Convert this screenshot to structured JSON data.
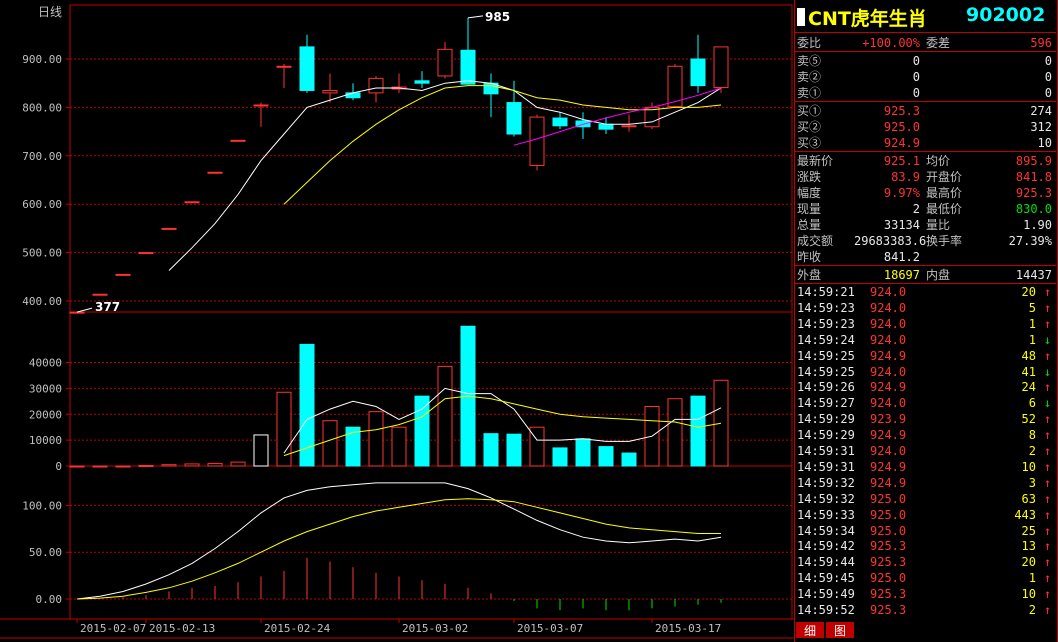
{
  "chart_area": {
    "period_label": "日线",
    "price_axis_ticks": [
      "900.00",
      "800.00",
      "700.00",
      "600.00",
      "500.00",
      "400.00"
    ],
    "price_axis_values": [
      900,
      800,
      700,
      600,
      500,
      400
    ],
    "volume_axis_ticks": [
      "40000",
      "30000",
      "20000",
      "10000",
      "0"
    ],
    "volume_axis_values": [
      40000,
      30000,
      20000,
      10000,
      0
    ],
    "indicator_axis_ticks": [
      "100.00",
      "50.00",
      "0.00"
    ],
    "indicator_axis_values": [
      100,
      50,
      0
    ],
    "date_labels": [
      "2015-02-07",
      "2015-02-13",
      "2015-02-24",
      "2015-03-02",
      "2015-03-07",
      "2015-03-17"
    ],
    "high_marker": "985",
    "low_marker": "377",
    "colors": {
      "up": "#ff3232",
      "down": "#00ffff",
      "grid": "#c00000",
      "ma_short": "#ffffff",
      "ma_long": "#ffff00",
      "ma_third": "#ff00ff"
    }
  },
  "chart_data": [
    {
      "type": "candlestick",
      "title": "",
      "ylim": [
        380,
        990
      ],
      "grid": true,
      "candles": [
        {
          "o": 377,
          "h": 377,
          "l": 377,
          "c": 377,
          "dir": "up"
        },
        {
          "o": 414,
          "h": 414,
          "l": 414,
          "c": 414,
          "dir": "up"
        },
        {
          "o": 455,
          "h": 455,
          "l": 455,
          "c": 455,
          "dir": "up"
        },
        {
          "o": 500,
          "h": 500,
          "l": 500,
          "c": 500,
          "dir": "up"
        },
        {
          "o": 550,
          "h": 550,
          "l": 550,
          "c": 550,
          "dir": "up"
        },
        {
          "o": 605,
          "h": 605,
          "l": 605,
          "c": 605,
          "dir": "up"
        },
        {
          "o": 666,
          "h": 666,
          "l": 666,
          "c": 666,
          "dir": "up"
        },
        {
          "o": 732,
          "h": 732,
          "l": 732,
          "c": 732,
          "dir": "up"
        },
        {
          "o": 805,
          "h": 810,
          "l": 760,
          "c": 805,
          "dir": "up"
        },
        {
          "o": 885,
          "h": 890,
          "l": 840,
          "c": 885,
          "dir": "up"
        },
        {
          "o": 925,
          "h": 950,
          "l": 830,
          "c": 835,
          "dir": "down"
        },
        {
          "o": 830,
          "h": 870,
          "l": 810,
          "c": 835,
          "dir": "up"
        },
        {
          "o": 830,
          "h": 850,
          "l": 815,
          "c": 820,
          "dir": "down"
        },
        {
          "o": 830,
          "h": 865,
          "l": 810,
          "c": 860,
          "dir": "up"
        },
        {
          "o": 838,
          "h": 870,
          "l": 830,
          "c": 842,
          "dir": "up"
        },
        {
          "o": 855,
          "h": 875,
          "l": 840,
          "c": 850,
          "dir": "down"
        },
        {
          "o": 865,
          "h": 935,
          "l": 860,
          "c": 920,
          "dir": "up"
        },
        {
          "o": 918,
          "h": 985,
          "l": 860,
          "c": 848,
          "dir": "down"
        },
        {
          "o": 850,
          "h": 870,
          "l": 780,
          "c": 828,
          "dir": "down"
        },
        {
          "o": 810,
          "h": 855,
          "l": 740,
          "c": 745,
          "dir": "down"
        },
        {
          "o": 680,
          "h": 785,
          "l": 670,
          "c": 780,
          "dir": "up"
        },
        {
          "o": 778,
          "h": 790,
          "l": 755,
          "c": 762,
          "dir": "down"
        },
        {
          "o": 772,
          "h": 790,
          "l": 735,
          "c": 760,
          "dir": "down"
        },
        {
          "o": 765,
          "h": 780,
          "l": 745,
          "c": 755,
          "dir": "down"
        },
        {
          "o": 760,
          "h": 785,
          "l": 750,
          "c": 762,
          "dir": "up"
        },
        {
          "o": 760,
          "h": 810,
          "l": 755,
          "c": 800,
          "dir": "up"
        },
        {
          "o": 802,
          "h": 890,
          "l": 800,
          "c": 885,
          "dir": "up"
        },
        {
          "o": 900,
          "h": 950,
          "l": 830,
          "c": 845,
          "dir": "down"
        },
        {
          "o": 841,
          "h": 925,
          "l": 830,
          "c": 925,
          "dir": "up"
        }
      ],
      "ma_short": [
        null,
        null,
        null,
        null,
        null,
        null,
        null,
        null,
        null,
        null,
        null,
        null,
        null,
        null,
        null,
        null,
        null,
        null,
        null,
        null,
        null,
        null,
        null,
        null,
        null,
        null,
        null,
        null,
        null
      ],
      "series": [
        {
          "name": "",
          "values": [
            null,
            null,
            null,
            null,
            463,
            510,
            560,
            620,
            690,
            745,
            800,
            815,
            830,
            840,
            840,
            835,
            850,
            855,
            850,
            835,
            800,
            790,
            775,
            765,
            765,
            770,
            790,
            810,
            840
          ]
        },
        {
          "name": "",
          "values": [
            null,
            null,
            null,
            null,
            null,
            null,
            null,
            null,
            null,
            600,
            645,
            690,
            730,
            765,
            795,
            820,
            840,
            845,
            845,
            835,
            820,
            815,
            805,
            800,
            795,
            795,
            800,
            800,
            805
          ]
        },
        {
          "name": "",
          "values": [
            null,
            null,
            null,
            null,
            null,
            null,
            null,
            null,
            null,
            null,
            null,
            null,
            null,
            null,
            null,
            null,
            null,
            null,
            null,
            722,
            735,
            750,
            765,
            778,
            790,
            800,
            812,
            825,
            840
          ]
        }
      ]
    },
    {
      "type": "bar",
      "title": "",
      "ylim": [
        0,
        48000
      ],
      "values": [
        0,
        0,
        0,
        200,
        500,
        800,
        1000,
        1500,
        12000,
        28500,
        47000,
        17500,
        15000,
        21000,
        15000,
        27000,
        38500,
        54000,
        12500,
        12300,
        15000,
        7000,
        10500,
        7500,
        5000,
        23000,
        26000,
        27000,
        33134
      ],
      "dirs": [
        "up",
        "up",
        "up",
        "up",
        "up",
        "up",
        "up",
        "up",
        "up",
        "up",
        "down",
        "up",
        "down",
        "up",
        "up",
        "down",
        "up",
        "down",
        "down",
        "down",
        "up",
        "down",
        "down",
        "down",
        "down",
        "up",
        "up",
        "down",
        "up"
      ],
      "series": [
        {
          "name": "",
          "values": [
            null,
            null,
            null,
            null,
            null,
            null,
            null,
            null,
            null,
            5000,
            18000,
            22000,
            25000,
            23000,
            18000,
            22000,
            30000,
            28000,
            28000,
            22000,
            10000,
            10000,
            10500,
            9500,
            9500,
            11500,
            18000,
            18000,
            22500
          ]
        },
        {
          "name": "",
          "values": [
            null,
            null,
            null,
            null,
            null,
            null,
            null,
            null,
            null,
            4000,
            7000,
            10000,
            13000,
            14000,
            16000,
            19000,
            26000,
            27000,
            26000,
            24000,
            22000,
            20000,
            19000,
            18500,
            18000,
            17500,
            17000,
            15000,
            16500
          ]
        }
      ]
    },
    {
      "type": "line",
      "title": "",
      "ylim": [
        -12,
        128
      ],
      "series": [
        {
          "name": "",
          "values": [
            0,
            3,
            8,
            16,
            26,
            38,
            54,
            72,
            92,
            108,
            116,
            120,
            122,
            124,
            124,
            124,
            124,
            118,
            108,
            96,
            84,
            74,
            66,
            62,
            60,
            62,
            64,
            62,
            66
          ]
        },
        {
          "name": "",
          "values": [
            0,
            1,
            3,
            7,
            12,
            19,
            28,
            38,
            50,
            62,
            72,
            80,
            88,
            94,
            98,
            102,
            106,
            107,
            106,
            104,
            98,
            92,
            86,
            80,
            76,
            74,
            72,
            70,
            70
          ]
        }
      ],
      "bars": [
        0,
        0,
        2,
        4,
        8,
        12,
        14,
        18,
        24,
        30,
        44,
        40,
        34,
        28,
        24,
        20,
        16,
        12,
        6,
        -2,
        -10,
        -12,
        -10,
        -12,
        -12,
        -10,
        -8,
        -6,
        -4
      ]
    }
  ],
  "panel": {
    "title": "CNT虎年生肖",
    "code": "902002",
    "weibi_label": "委比",
    "weibi_value": "+100.00%",
    "weicha_label": "委差",
    "weicha_value": "596",
    "sell_levels": [
      {
        "label": "卖⑤",
        "price": "0",
        "vol": "0"
      },
      {
        "label": "卖②",
        "price": "0",
        "vol": "0"
      },
      {
        "label": "卖①",
        "price": "0",
        "vol": "0"
      }
    ],
    "buy_levels": [
      {
        "label": "买①",
        "price": "925.3",
        "vol": "274"
      },
      {
        "label": "买②",
        "price": "925.0",
        "vol": "312"
      },
      {
        "label": "买③",
        "price": "924.9",
        "vol": "10"
      }
    ],
    "stats_left": [
      {
        "label": "最新价",
        "value": "925.1",
        "color": "red"
      },
      {
        "label": "涨跌",
        "value": "83.9",
        "color": "red"
      },
      {
        "label": "幅度",
        "value": "9.97%",
        "color": "red"
      },
      {
        "label": "现量",
        "value": "2",
        "color": "lab"
      },
      {
        "label": "总量",
        "value": "33134",
        "color": "lab"
      },
      {
        "label": "成交额",
        "value": "29683383.6",
        "color": "lab"
      },
      {
        "label": "昨收",
        "value": "841.2",
        "color": "lab"
      }
    ],
    "stats_right": [
      {
        "label": "均价",
        "value": "895.9",
        "color": "red"
      },
      {
        "label": "开盘价",
        "value": "841.8",
        "color": "red"
      },
      {
        "label": "最高价",
        "value": "925.3",
        "color": "red"
      },
      {
        "label": "最低价",
        "value": "830.0",
        "color": "grn"
      },
      {
        "label": "量比",
        "value": "1.90",
        "color": "lab"
      },
      {
        "label": "换手率",
        "value": "27.39%",
        "color": "lab"
      }
    ],
    "outer_label": "外盘",
    "outer_value": "18697",
    "inner_label": "内盘",
    "inner_value": "14437",
    "ticks": [
      {
        "time": "14:59:21",
        "price": "924.0",
        "vol": "20",
        "dir": "up"
      },
      {
        "time": "14:59:23",
        "price": "924.0",
        "vol": "5",
        "dir": "up"
      },
      {
        "time": "14:59:23",
        "price": "924.0",
        "vol": "1",
        "dir": "up"
      },
      {
        "time": "14:59:24",
        "price": "924.0",
        "vol": "1",
        "dir": "down"
      },
      {
        "time": "14:59:25",
        "price": "924.9",
        "vol": "48",
        "dir": "up"
      },
      {
        "time": "14:59:25",
        "price": "924.0",
        "vol": "41",
        "dir": "down"
      },
      {
        "time": "14:59:26",
        "price": "924.9",
        "vol": "24",
        "dir": "up"
      },
      {
        "time": "14:59:27",
        "price": "924.0",
        "vol": "6",
        "dir": "down"
      },
      {
        "time": "14:59:29",
        "price": "923.9",
        "vol": "52",
        "dir": "up"
      },
      {
        "time": "14:59:29",
        "price": "924.9",
        "vol": "8",
        "dir": "up"
      },
      {
        "time": "14:59:31",
        "price": "924.0",
        "vol": "2",
        "dir": "up"
      },
      {
        "time": "14:59:31",
        "price": "924.9",
        "vol": "10",
        "dir": "up"
      },
      {
        "time": "14:59:32",
        "price": "924.9",
        "vol": "3",
        "dir": "up"
      },
      {
        "time": "14:59:32",
        "price": "925.0",
        "vol": "63",
        "dir": "up"
      },
      {
        "time": "14:59:33",
        "price": "925.0",
        "vol": "443",
        "dir": "up"
      },
      {
        "time": "14:59:34",
        "price": "925.0",
        "vol": "25",
        "dir": "up"
      },
      {
        "time": "14:59:42",
        "price": "925.3",
        "vol": "13",
        "dir": "up"
      },
      {
        "time": "14:59:44",
        "price": "925.3",
        "vol": "20",
        "dir": "up"
      },
      {
        "time": "14:59:45",
        "price": "925.0",
        "vol": "1",
        "dir": "up"
      },
      {
        "time": "14:59:49",
        "price": "925.3",
        "vol": "10",
        "dir": "up"
      },
      {
        "time": "14:59:52",
        "price": "925.3",
        "vol": "2",
        "dir": "up"
      }
    ],
    "tabs": [
      "细",
      "图"
    ]
  }
}
